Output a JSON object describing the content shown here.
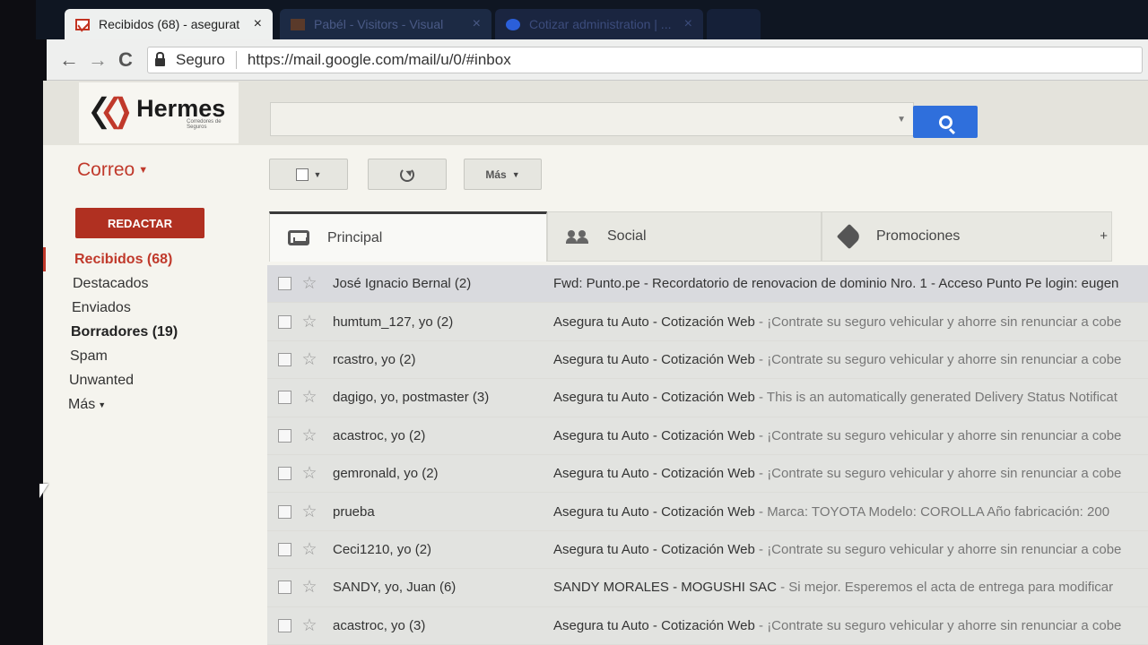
{
  "browser": {
    "tabs": [
      {
        "title": "Recibidos (68) - asegurat",
        "close": "×"
      },
      {
        "title": "Pabél - Visitors - Visual",
        "close": "×"
      },
      {
        "title": "Cotizar administration | ...",
        "close": "×"
      }
    ],
    "secure_label": "Seguro",
    "url": "https://mail.google.com/mail/u/0/#inbox",
    "back": "←",
    "forward": "→",
    "reload": "C"
  },
  "brand": {
    "name": "Hermes",
    "tagline": "Corredores de Seguros",
    "colors": {
      "red": "#c0392b",
      "dark": "#1b1b1b"
    }
  },
  "gmail": {
    "app_label": "Correo",
    "compose_label": "REDACTAR",
    "toolbar": {
      "more_label": "Más"
    },
    "folders": [
      {
        "label": "Recibidos (68)"
      },
      {
        "label": "Destacados"
      },
      {
        "label": "Enviados"
      },
      {
        "label": "Borradores (19)"
      },
      {
        "label": "Spam"
      },
      {
        "label": "Unwanted"
      },
      {
        "label": "Más"
      }
    ],
    "tabs": [
      {
        "label": "Principal"
      },
      {
        "label": "Social"
      },
      {
        "label": "Promociones"
      }
    ],
    "add_tab": "+",
    "emails": [
      {
        "sender": "José Ignacio Bernal (2)",
        "subject": "Fwd: Punto.pe - Recordatorio de renovacion de dominio Nro. 1 - Acceso Punto Pe login: eugen",
        "snippet": ""
      },
      {
        "sender": "humtum_127, yo (2)",
        "subject": "Asegura tu Auto - Cotización Web",
        "snippet": " - ¡Contrate su seguro vehicular y ahorre sin renunciar a cobe"
      },
      {
        "sender": "rcastro, yo (2)",
        "subject": "Asegura tu Auto - Cotización Web",
        "snippet": " - ¡Contrate su seguro vehicular y ahorre sin renunciar a cobe"
      },
      {
        "sender": "dagigo, yo, postmaster (3)",
        "subject": "Asegura tu Auto - Cotización Web",
        "snippet": " - This is an automatically generated Delivery Status Notificat"
      },
      {
        "sender": "acastroc, yo (2)",
        "subject": "Asegura tu Auto - Cotización Web",
        "snippet": " - ¡Contrate su seguro vehicular y ahorre sin renunciar a cobe"
      },
      {
        "sender": "gemronald, yo (2)",
        "subject": "Asegura tu Auto - Cotización Web",
        "snippet": " - ¡Contrate su seguro vehicular y ahorre sin renunciar a cobe"
      },
      {
        "sender": "prueba",
        "subject": "Asegura tu Auto - Cotización Web",
        "snippet": " - Marca: TOYOTA Modelo: COROLLA Año fabricación: 200"
      },
      {
        "sender": "Ceci1210, yo (2)",
        "subject": "Asegura tu Auto - Cotización Web",
        "snippet": " - ¡Contrate su seguro vehicular y ahorre sin renunciar a cobe"
      },
      {
        "sender": "SANDY, yo, Juan (6)",
        "subject": "SANDY MORALES - MOGUSHI SAC",
        "snippet": " - Si mejor. Esperemos el acta de entrega para modificar"
      },
      {
        "sender": "acastroc, yo (3)",
        "subject": "Asegura tu Auto - Cotización Web",
        "snippet": " - ¡Contrate su seguro vehicular y ahorre sin renunciar a cobe"
      }
    ]
  }
}
